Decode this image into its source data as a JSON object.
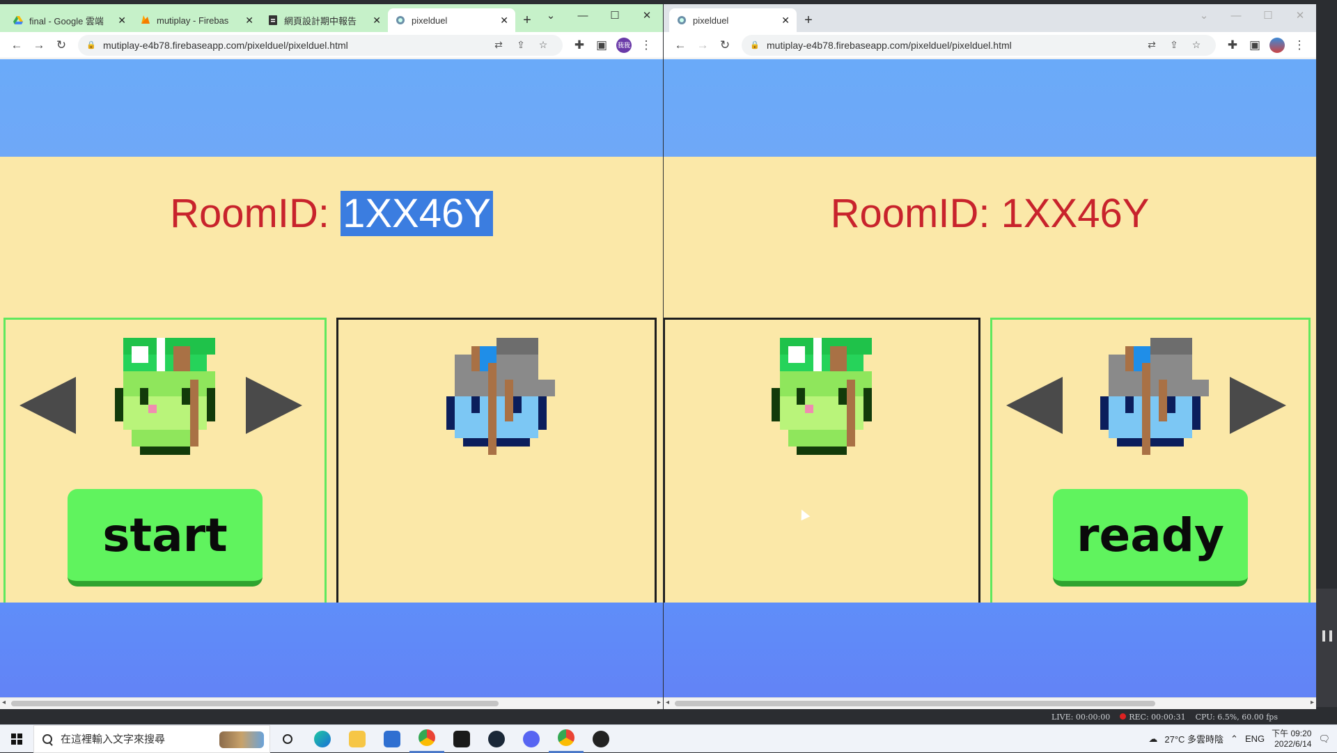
{
  "left_window": {
    "tabs": [
      {
        "title": "final - Google 雲端",
        "icon": "google-drive-icon"
      },
      {
        "title": "mutiplay - Firebas",
        "icon": "firebase-icon"
      },
      {
        "title": "網頁設計期中報告",
        "icon": "docs-icon"
      },
      {
        "title": "pixelduel",
        "icon": "pixelduel-icon",
        "active": true
      }
    ],
    "url": "mutiplay-e4b78.firebaseapp.com/pixelduel/pixelduel.html",
    "avatar": "我我",
    "room": {
      "label": "RoomID: ",
      "id": "1XX46Y"
    },
    "action_button": "start"
  },
  "right_window": {
    "tabs": [
      {
        "title": "pixelduel",
        "icon": "pixelduel-icon",
        "active": true
      }
    ],
    "url": "mutiplay-e4b78.firebaseapp.com/pixelduel/pixelduel.html",
    "room": {
      "label": "RoomID: ",
      "id": "1XX46Y"
    },
    "action_button": "ready"
  },
  "recording_status": {
    "live": "LIVE: 00:00:00",
    "rec": "REC: 00:00:31",
    "cpu": "CPU: 6.5%, 60.00 fps"
  },
  "taskbar": {
    "search_placeholder": "在這裡輸入文字來搜尋",
    "weather": "27°C 多雲時陰",
    "language": "ENG",
    "time": "下午 09:20",
    "date": "2022/6/14"
  },
  "colors": {
    "room_text": "#c8232c",
    "sand": "#fbe8a8",
    "sky": "#6aaaf9",
    "button": "#60f35e",
    "selected_border": "#5fe85d"
  }
}
